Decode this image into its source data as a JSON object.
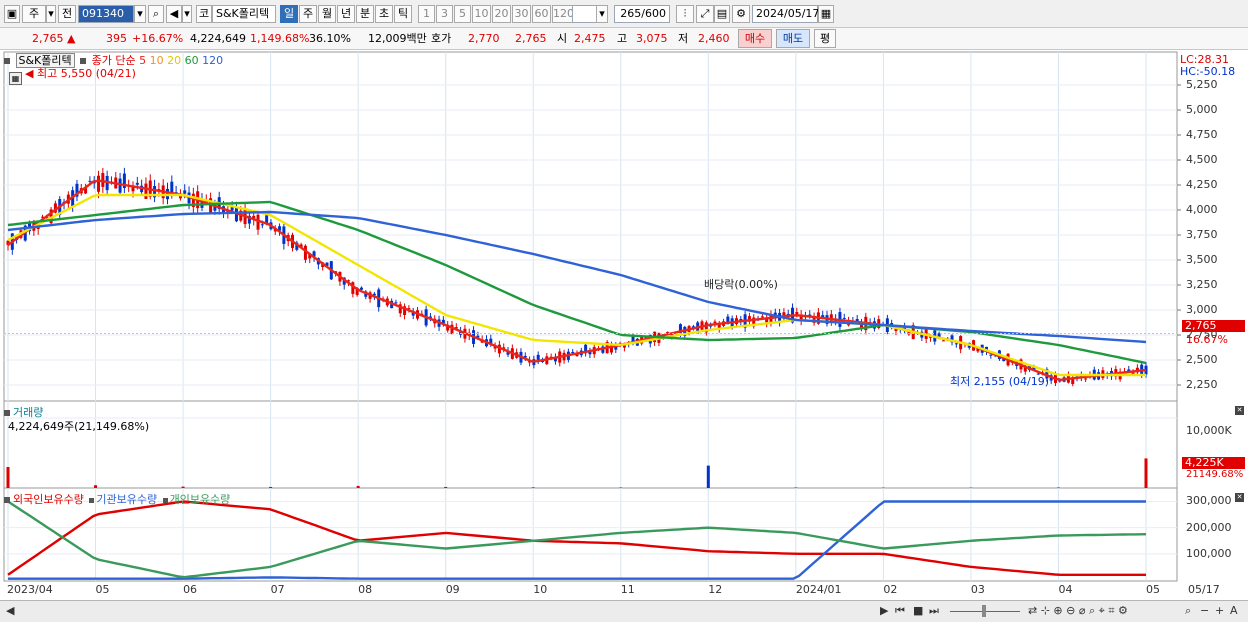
{
  "toolbar": {
    "market_type": "주",
    "view_type": "전",
    "stock_code": "091340",
    "market_prefix": "코",
    "stock_name": "S&K폴리텍",
    "periods": [
      "일",
      "주",
      "월",
      "년",
      "분",
      "초",
      "틱"
    ],
    "active_period": "일",
    "intervals": [
      "1",
      "3",
      "5",
      "10",
      "20",
      "30",
      "60",
      "120"
    ],
    "count_current": "265",
    "count_total": "/600",
    "date": "2024/05/17"
  },
  "info": {
    "price": "2,765",
    "change": "395",
    "change_pct": "+16.67%",
    "volume": "4,224,649",
    "volume_pct": "1,149.68%",
    "turnover": "36.10%",
    "amount": "12,009백만",
    "bid_label": "호가",
    "ask": "2,770",
    "bid": "2,765",
    "open_label": "시",
    "open": "2,475",
    "high_label": "고",
    "high": "3,075",
    "low_label": "저",
    "low": "2,460",
    "buy_button": "매수",
    "sell_button": "매도",
    "avg_button": "평"
  },
  "price_panel": {
    "title": "S&K폴리텍",
    "ma_title": "종가 단순",
    "ma_periods": [
      "5",
      "10",
      "20",
      "60",
      "120"
    ],
    "ma_colors": [
      "#e8261b",
      "#f0932a",
      "#f2e600",
      "#1e9a3c",
      "#2e62d6"
    ],
    "high_annotation": "최고 5,550 (04/21)",
    "low_annotation": "최저 2,155 (04/19)",
    "dividend_annotation": "배당락(0.00%)",
    "lc": "LC:28.31",
    "hc": "HC:-50.18",
    "current_price_tag": "2,765",
    "current_pct_tag": "16.67%",
    "y_ticks": [
      "5,250",
      "5,000",
      "4,750",
      "4,500",
      "4,250",
      "4,000",
      "3,750",
      "3,500",
      "3,250",
      "3,000",
      "2,750",
      "2,500",
      "2,250"
    ]
  },
  "volume_panel": {
    "title": "거래량",
    "value_label": "4,224,649주(21,149.68%)",
    "y_tick": "10,000K",
    "current_tag": "4,225K",
    "current_pct_tag": "21149.68%"
  },
  "holder_panel": {
    "foreign_label": "외국인보유수량",
    "institution_label": "기관보유수량",
    "individual_label": "개인보유수량",
    "y_ticks": [
      "300,000",
      "200,000",
      "100,000"
    ]
  },
  "x_axis": {
    "labels": [
      "2023/04",
      "05",
      "06",
      "07",
      "08",
      "09",
      "10",
      "11",
      "12",
      "2024/01",
      "02",
      "03",
      "04",
      "05"
    ],
    "last_date": "05/17"
  },
  "colors": {
    "up": "#e00000",
    "down": "#0033cc",
    "foreign": "#e00000",
    "institution": "#2e62d6",
    "individual": "#3a9a5c"
  },
  "chart_data": [
    {
      "type": "line",
      "title": "S&K폴리텍",
      "series": [
        {
          "name": "5",
          "x": [
            "2023/04",
            "05",
            "06",
            "07",
            "08",
            "09",
            "10",
            "11",
            "12",
            "2024/01",
            "02",
            "03",
            "04",
            "05/17"
          ],
          "values": [
            3650,
            4300,
            4150,
            3850,
            3200,
            2850,
            2480,
            2650,
            2850,
            2950,
            2850,
            2650,
            2300,
            2400
          ]
        },
        {
          "name": "20",
          "x": [
            "2023/04",
            "05",
            "06",
            "07",
            "08",
            "09",
            "10",
            "11",
            "12",
            "2024/01",
            "02",
            "03",
            "04",
            "05/17"
          ],
          "values": [
            3700,
            4150,
            4150,
            3950,
            3450,
            2950,
            2700,
            2650,
            2800,
            2900,
            2850,
            2650,
            2350,
            2350
          ]
        },
        {
          "name": "60",
          "x": [
            "2023/04",
            "05",
            "06",
            "07",
            "08",
            "09",
            "10",
            "11",
            "12",
            "2024/01",
            "02",
            "03",
            "04",
            "05/17"
          ],
          "values": [
            3850,
            3950,
            4050,
            4080,
            3800,
            3450,
            3050,
            2750,
            2700,
            2720,
            2850,
            2780,
            2650,
            2470
          ]
        },
        {
          "name": "120",
          "x": [
            "2023/04",
            "05",
            "06",
            "07",
            "08",
            "09",
            "10",
            "11",
            "12",
            "2024/01",
            "02",
            "03",
            "04",
            "05/17"
          ],
          "values": [
            3800,
            3900,
            3960,
            3980,
            3920,
            3750,
            3560,
            3350,
            3080,
            2900,
            2850,
            2790,
            2740,
            2680
          ]
        }
      ],
      "ylim": [
        2100,
        5550
      ]
    },
    {
      "type": "bar",
      "title": "거래량",
      "categories": [
        "2023/04",
        "05",
        "06",
        "07",
        "08",
        "09",
        "10",
        "11",
        "12",
        "2024/01",
        "02",
        "03",
        "04",
        "05/17"
      ],
      "values": [
        3000,
        400,
        200,
        150,
        300,
        150,
        100,
        80,
        3200,
        80,
        60,
        60,
        80,
        4225
      ],
      "ylim": [
        0,
        12000
      ]
    },
    {
      "type": "line",
      "series": [
        {
          "name": "외국인보유수량",
          "x": [
            "2023/04",
            "05",
            "06",
            "07",
            "08",
            "09",
            "10",
            "11",
            "12",
            "2024/01",
            "02",
            "03",
            "04",
            "05/17"
          ],
          "values": [
            20000,
            250000,
            300000,
            270000,
            150000,
            180000,
            150000,
            140000,
            110000,
            100000,
            100000,
            50000,
            20000,
            20000
          ]
        },
        {
          "name": "기관보유수량",
          "x": [
            "2023/04",
            "05",
            "06",
            "07",
            "08",
            "09",
            "10",
            "11",
            "12",
            "2024/01",
            "02",
            "03",
            "04",
            "05/17"
          ],
          "values": [
            5000,
            5000,
            5000,
            10000,
            5000,
            5000,
            5000,
            5000,
            5000,
            5000,
            300000,
            300000,
            300000,
            300000
          ]
        },
        {
          "name": "개인보유수량",
          "x": [
            "2023/04",
            "05",
            "06",
            "07",
            "08",
            "09",
            "10",
            "11",
            "12",
            "2024/01",
            "02",
            "03",
            "04",
            "05/17"
          ],
          "values": [
            300000,
            80000,
            10000,
            50000,
            150000,
            120000,
            150000,
            180000,
            200000,
            180000,
            120000,
            150000,
            170000,
            175000
          ]
        }
      ],
      "ylim": [
        0,
        340000
      ]
    }
  ]
}
